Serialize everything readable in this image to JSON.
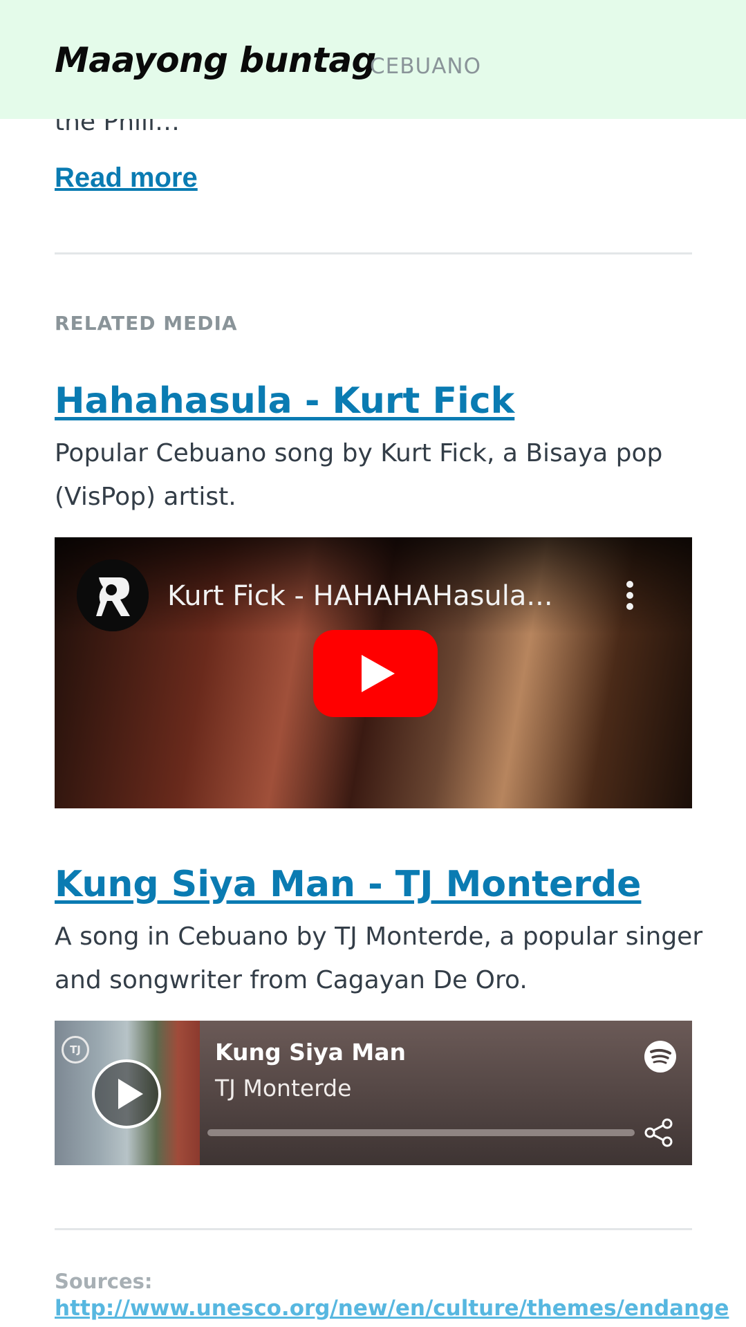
{
  "header": {
    "title": "Maayong buntag",
    "language": "CEBUANO"
  },
  "article": {
    "truncated_text": "the Phili…",
    "read_more": "Read more"
  },
  "related_media": {
    "label": "RELATED MEDIA",
    "items": [
      {
        "title": "Hahahasula - Kurt Fick",
        "description": "Popular Cebuano song by Kurt Fick, a Bisaya pop (VisPop) artist.",
        "embed": {
          "type": "youtube",
          "video_title": "Kurt Fick - HAHAHAHasula...",
          "play_icon": "youtube-play-icon",
          "menu_icon": "more-vert-icon"
        }
      },
      {
        "title": "Kung Siya Man - TJ Monterde",
        "description": "A song in Cebuano by TJ Monterde, a popular singer and songwriter from Cagayan De Oro.",
        "embed": {
          "type": "spotify",
          "track": "Kung Siya Man",
          "artist": "TJ Monterde",
          "badge": "TJ",
          "progress": 0.0
        }
      }
    ]
  },
  "sources": {
    "label": "Sources:",
    "link": "http://www.unesco.org/new/en/culture/themes/endange"
  },
  "colors": {
    "header_bg": "#e4fbea",
    "link": "#0a7bb2",
    "muted": "#8a9499",
    "youtube_red": "#ff0000",
    "source_link": "#57b7e0"
  }
}
